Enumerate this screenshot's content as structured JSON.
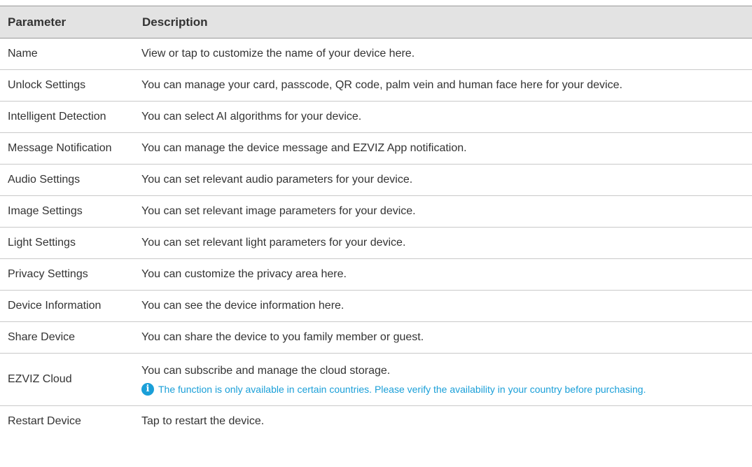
{
  "table": {
    "headers": {
      "parameter": "Parameter",
      "description": "Description"
    },
    "rows": [
      {
        "parameter": "Name",
        "description": "View or tap to customize the name of your device here."
      },
      {
        "parameter": "Unlock Settings",
        "description": "You can manage your card, passcode, QR code, palm vein and human face here for your device."
      },
      {
        "parameter": "Intelligent Detection",
        "description": "You can select AI algorithms for your device."
      },
      {
        "parameter": "Message Notification",
        "description": "You can manage the device message and EZVIZ App notification."
      },
      {
        "parameter": "Audio Settings",
        "description": "You can set relevant audio parameters for your device."
      },
      {
        "parameter": "Image Settings",
        "description": "You can set relevant image parameters for your device."
      },
      {
        "parameter": "Light Settings",
        "description": "You can set relevant light parameters for your device."
      },
      {
        "parameter": "Privacy Settings",
        "description": "You can customize the privacy area here."
      },
      {
        "parameter": "Device Information",
        "description": "You can see the device information here."
      },
      {
        "parameter": "Share Device",
        "description": "You can share the device to you family member or guest."
      },
      {
        "parameter": "EZVIZ Cloud",
        "description": "You can subscribe and manage the cloud storage.",
        "note": "The function is only available in certain countries. Please verify the availability in your country before purchasing.",
        "note_icon": "info-icon"
      },
      {
        "parameter": "Restart Device",
        "description": "Tap to restart the device."
      }
    ]
  },
  "colors": {
    "header_bg": "#e3e3e3",
    "note": "#1a9fd8",
    "text": "#333333"
  }
}
